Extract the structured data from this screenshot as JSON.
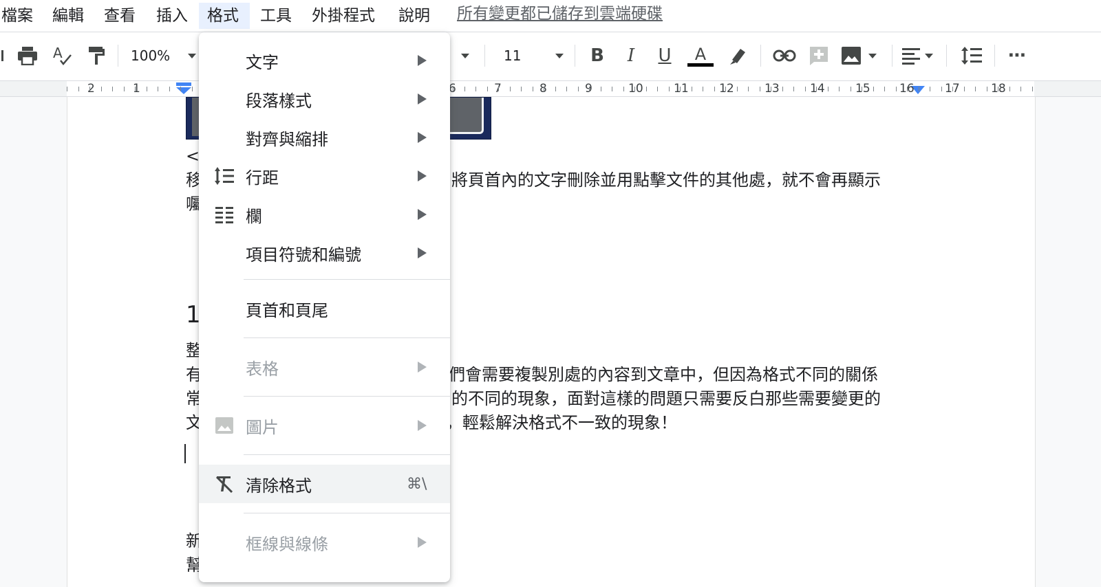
{
  "menubar": {
    "items": [
      {
        "label": "檔案"
      },
      {
        "label": "編輯"
      },
      {
        "label": "查看"
      },
      {
        "label": "插入"
      },
      {
        "label": "格式"
      },
      {
        "label": "工具"
      },
      {
        "label": "外掛程式"
      },
      {
        "label": "說明"
      }
    ],
    "active_index": 4,
    "save_status": "所有變更都已儲存到雲端硬碟"
  },
  "toolbar": {
    "icons": [
      "print-icon",
      "spellcheck-icon",
      "paint-format-icon",
      "bold-icon",
      "italic-icon",
      "underline-icon",
      "text-color-icon",
      "highlight-icon",
      "link-icon",
      "add-comment-icon",
      "insert-image-icon",
      "align-icon",
      "line-spacing-icon",
      "more-icon"
    ],
    "zoom": "100%",
    "font_size": "11",
    "bold_label": "B",
    "italic_label": "I",
    "underline_label": "U",
    "text_color_label": "A",
    "more_label": "⋯"
  },
  "ruler": {
    "labels": [
      "2",
      "1",
      "6",
      "7",
      "8",
      "9",
      "10",
      "11",
      "12",
      "13",
      "14",
      "15",
      "16",
      "17",
      "18"
    ]
  },
  "document": {
    "lines": [
      {
        "text": "<ꝏ",
        "kind": "partial"
      },
      {
        "text": "移",
        "kind": "partial"
      },
      {
        "text": "將頁首內的文字刪除並用點擊文件的其他處，就不會再顯示",
        "kind": "text"
      },
      {
        "text": "囑",
        "kind": "partial"
      },
      {
        "text": "1",
        "kind": "heading"
      },
      {
        "text": "整",
        "kind": "partial"
      },
      {
        "text": "有",
        "kind": "partial"
      },
      {
        "text": "們會需要複製別處的內容到文章中，但因為格式不同的關係",
        "kind": "text"
      },
      {
        "text": "常",
        "kind": "partial"
      },
      {
        "text": "的不同的現象，面對這樣的問題只需要反白那些需要變更的",
        "kind": "text"
      },
      {
        "text": "文",
        "kind": "partial"
      },
      {
        "text": "，輕鬆解決格式不一致的現象！",
        "kind": "text"
      },
      {
        "text": "新",
        "kind": "partial"
      },
      {
        "text": "幫",
        "kind": "partial"
      }
    ]
  },
  "format_menu": {
    "items": [
      {
        "label": "文字",
        "submenu": true,
        "disabled": false,
        "icon": ""
      },
      {
        "label": "段落樣式",
        "submenu": true,
        "disabled": false,
        "icon": ""
      },
      {
        "label": "對齊與縮排",
        "submenu": true,
        "disabled": false,
        "icon": ""
      },
      {
        "label": "行距",
        "submenu": true,
        "disabled": false,
        "icon": "line-spacing-icon"
      },
      {
        "label": "欄",
        "submenu": true,
        "disabled": false,
        "icon": "columns-icon"
      },
      {
        "label": "項目符號和編號",
        "submenu": true,
        "disabled": false,
        "icon": ""
      },
      {
        "label": "頁首和頁尾",
        "submenu": false,
        "disabled": false,
        "icon": ""
      },
      {
        "label": "表格",
        "submenu": true,
        "disabled": true,
        "icon": ""
      },
      {
        "label": "圖片",
        "submenu": true,
        "disabled": true,
        "icon": "image-icon"
      },
      {
        "label": "清除格式",
        "submenu": false,
        "disabled": false,
        "icon": "clear-formatting-icon",
        "shortcut": "⌘\\",
        "hovered": true
      },
      {
        "label": "框線與線條",
        "submenu": true,
        "disabled": true,
        "icon": ""
      }
    ]
  },
  "colors": {
    "accent_blue": "#1a73e8",
    "menu_active_bg": "#e8f0fe",
    "disabled_text": "#9aa0a6"
  }
}
